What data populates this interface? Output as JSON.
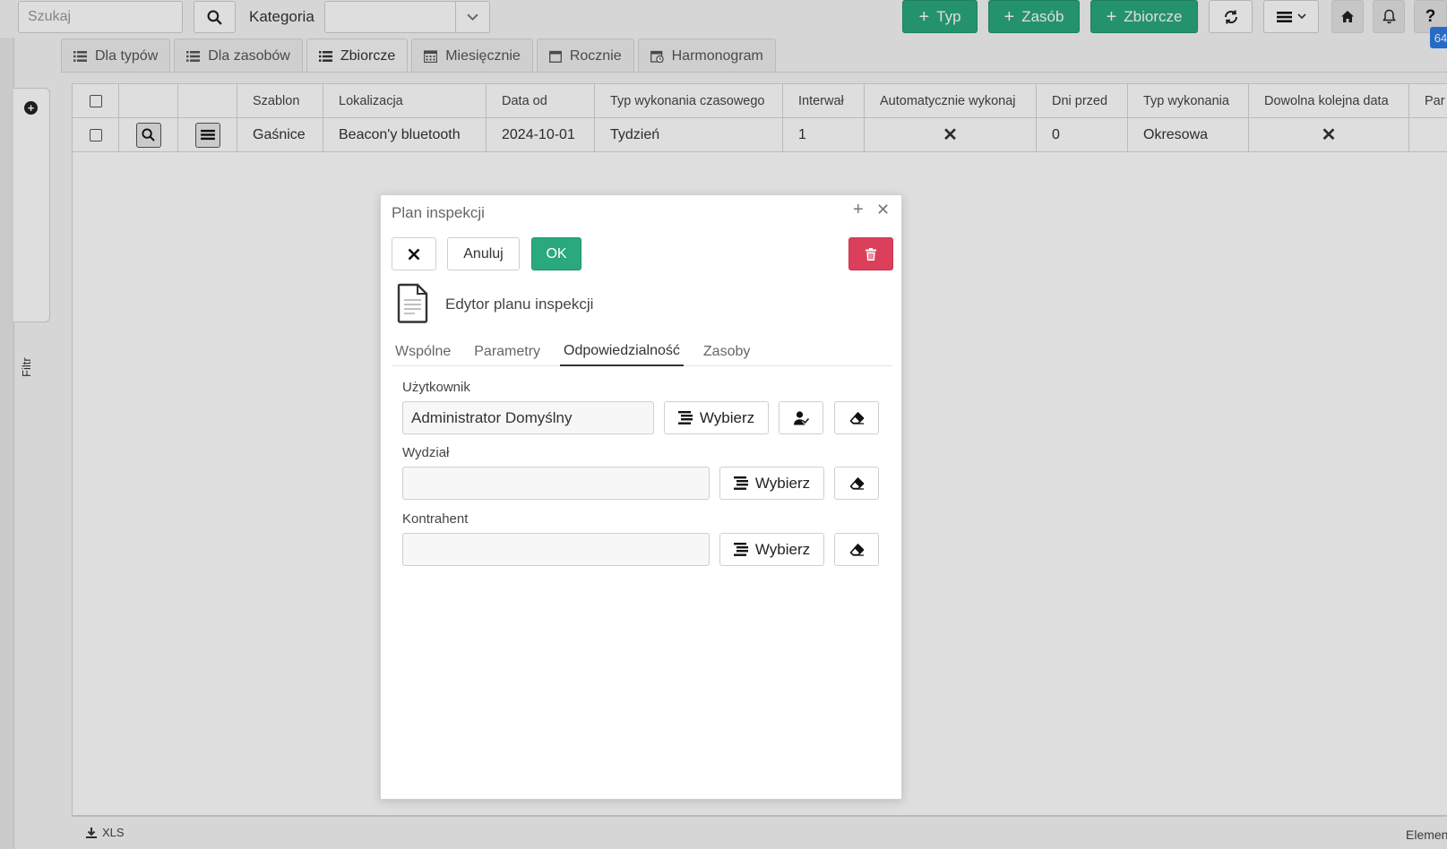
{
  "toolbar": {
    "search_placeholder": "Szukaj",
    "category_label": "Kategoria",
    "category_value": "",
    "add_type": "Typ",
    "add_resource": "Zasób",
    "add_collective": "Zbiorcze",
    "badge": "64"
  },
  "filter_panel": {
    "label": "Filtr"
  },
  "tabs": [
    {
      "label": "Dla typów",
      "icon": "list-icon"
    },
    {
      "label": "Dla zasobów",
      "icon": "list-icon"
    },
    {
      "label": "Zbiorcze",
      "icon": "list-icon"
    },
    {
      "label": "Miesięcznie",
      "icon": "calendar-grid-icon"
    },
    {
      "label": "Rocznie",
      "icon": "calendar-icon"
    },
    {
      "label": "Harmonogram",
      "icon": "calendar-clock-icon"
    }
  ],
  "grid": {
    "columns": [
      "Szablon",
      "Lokalizacja",
      "Data od",
      "Typ wykonania czasowego",
      "Interwał",
      "Automatycznie wykonaj",
      "Dni przed",
      "Typ wykonania",
      "Dowolna kolejna data",
      "Par"
    ],
    "rows": [
      {
        "template": "Gaśnice",
        "location": "Beacon'y bluetooth",
        "date_from": "2024-10-01",
        "time_type": "Tydzień",
        "interval": "1",
        "auto_execute": "✕",
        "days_before": "0",
        "exec_type": "Okresowa",
        "any_next_date": "✕",
        "par": ""
      }
    ]
  },
  "footer": {
    "export": "XLS",
    "elements": "Elementy"
  },
  "dialog": {
    "title": "Plan inspekcji",
    "cancel": "Anuluj",
    "ok": "OK",
    "editor_title": "Edytor planu inspekcji",
    "tabs": [
      "Wspólne",
      "Parametry",
      "Odpowiedzialność",
      "Zasoby"
    ],
    "active_tab": "Odpowiedzialność",
    "fields": {
      "user": {
        "label": "Użytkownik",
        "value": "Administrator Domyślny"
      },
      "department": {
        "label": "Wydział",
        "value": ""
      },
      "contractor": {
        "label": "Kontrahent",
        "value": ""
      }
    },
    "choose": "Wybierz"
  },
  "colors": {
    "green": "#2aa87e",
    "red": "#dc3f5c",
    "badge": "#2c7be5"
  }
}
